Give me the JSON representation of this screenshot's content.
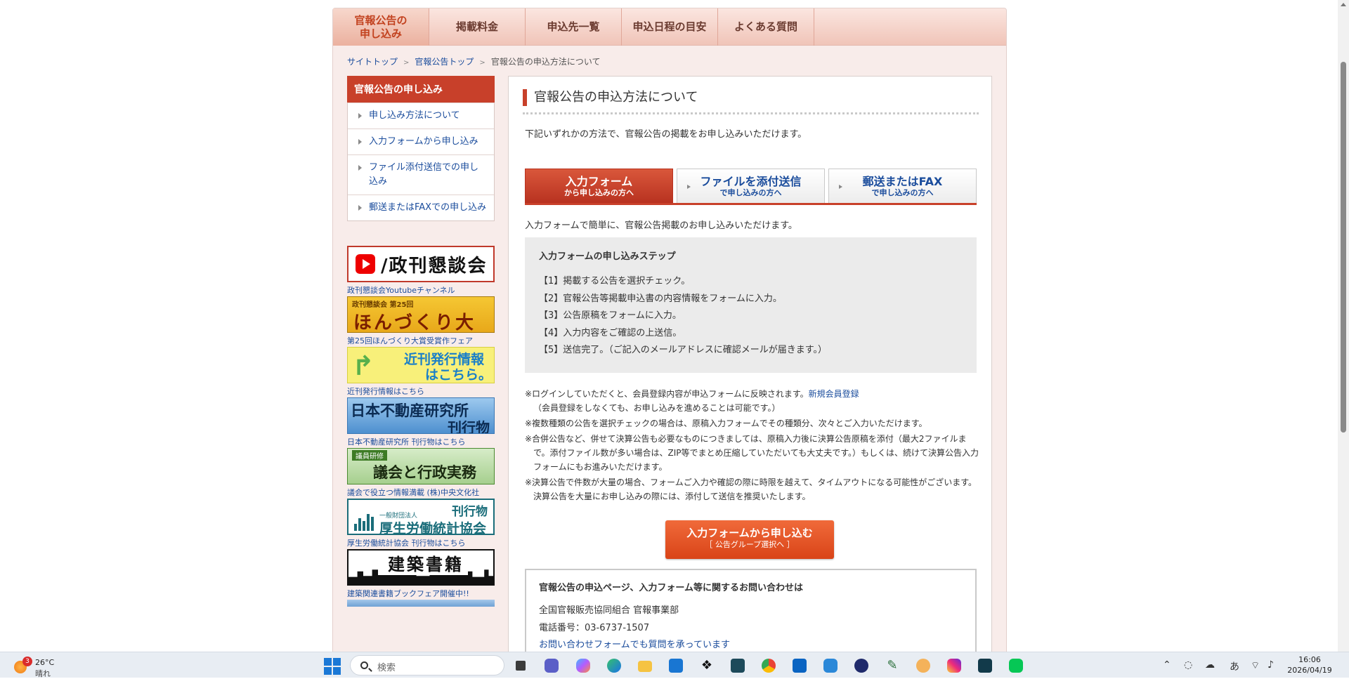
{
  "nav": {
    "tabs": [
      {
        "label": "官報公告の\n申し込み",
        "active": true
      },
      {
        "label": "掲載料金",
        "active": false
      },
      {
        "label": "申込先一覧",
        "active": false
      },
      {
        "label": "申込日程の目安",
        "active": false
      },
      {
        "label": "よくある質問",
        "active": false
      }
    ]
  },
  "breadcrumb": {
    "items": [
      "サイトトップ",
      "官報公告トップ",
      "官報公告の申込方法について"
    ]
  },
  "sidebar": {
    "heading": "官報公告の申し込み",
    "items": [
      "申し込み方法について",
      "入力フォームから申し込み",
      "ファイル添付送信での申し込み",
      "郵送またはFAXでの申し込み"
    ]
  },
  "banners": {
    "seikan": {
      "text": "/政刊懇談会",
      "caption": "政刊懇談会Youtubeチャンネル",
      "icon": "youtube-icon"
    },
    "honzukuri": {
      "small": "政刊懇談会 第25回",
      "big": "ほんづくり大賞",
      "caption": "第25回ほんづくり大賞受賞作フェア"
    },
    "kinkan": {
      "l1": "近刊発行情報",
      "l2": "はこちら。",
      "caption": "近刊発行情報はこちら"
    },
    "fudosan": {
      "l1": "日本不動産研究所",
      "l2": "刊行物",
      "caption": "日本不動産研究所 刊行物はこちら"
    },
    "gikai": {
      "tag": "議員研修",
      "big": "議会と行政実務",
      "caption": "議会で役立つ情報満載 (株)中央文化社"
    },
    "kosei": {
      "org": "一般財団法人",
      "name": "厚生労働統計協会",
      "kan": "刊行物",
      "caption": "厚生労働統計協会 刊行物はこちら"
    },
    "kenchiku": {
      "title": "建築書籍",
      "caption": "建築関連書籍ブックフェア開催中!!"
    }
  },
  "main": {
    "title": "官報公告の申込方法について",
    "intro": "下記いずれかの方法で、官報公告の掲載をお申し込みいただけます。",
    "tabs": [
      {
        "l1": "入力フォーム",
        "l2": "から申し込みの方へ",
        "active": true
      },
      {
        "l1": "ファイルを添付送信",
        "l2": "で申し込みの方へ",
        "active": false
      },
      {
        "l1": "郵送またはFAX",
        "l2": "で申し込みの方へ",
        "active": false
      }
    ],
    "form_desc": "入力フォームで簡単に、官報公告掲載のお申し込みいただけます。",
    "steps": {
      "heading": "入力フォームの申し込みステップ",
      "items": [
        "【1】掲載する公告を選択チェック。",
        "【2】官報公告等掲載申込書の内容情報をフォームに入力。",
        "【3】公告原稿をフォームに入力。",
        "【4】入力内容をご確認の上送信。",
        "【5】送信完了。（ご記入のメールアドレスに確認メールが届きます。）"
      ]
    },
    "notes": {
      "n1": "※ログインしていただくと、会員登録内容が申込フォームに反映されます。",
      "n1_link": "新規会員登録",
      "n1_sub": "（会員登録をしなくても、お申し込みを進めることは可能です。）",
      "n2": "※複数種類の公告を選択チェックの場合は、原稿入力フォームでその種類分、次々とご入力いただけます。",
      "n3": "※合併公告など、併せて決算公告も必要なものにつきましては、原稿入力後に決算公告原稿を添付（最大2ファイルまで。添付ファイル数が多い場合は、ZIP等でまとめ圧縮していただいても大丈夫です。）もしくは、続けて決算公告入力フォームにもお進みいただけます。",
      "n4": "※決算公告で件数が大量の場合、フォームご入力や確認の際に時限を越えて、タイムアウトになる可能性がございます。決算公告を大量にお申し込みの際には、添付して送信を推奨いたします。"
    },
    "cta": {
      "l1": "入力フォームから申し込む",
      "l2": "［ 公告グループ選択へ ］"
    },
    "contact": {
      "heading": "官報公告の申込ページ、入力フォーム等に関するお問い合わせは",
      "org": "全国官報販売協同組合 官報事業部",
      "tel": "電話番号：03-6737-1507",
      "link": "お問い合わせフォームでも質問を承っています"
    }
  },
  "taskbar": {
    "weather": {
      "temp": "26°C",
      "cond": "晴れ",
      "badge": "3"
    },
    "search_placeholder": "検索",
    "apps": [
      "file-explorer-icon",
      "teams-icon",
      "copilot-icon",
      "edge-icon",
      "folder-icon",
      "store-icon",
      "dropbox-icon",
      "app-s-icon",
      "chrome-icon",
      "outlook-icon",
      "outlook-new-icon",
      "app-circle-icon",
      "app-pen-icon",
      "app-flower-icon",
      "instagram-icon",
      "app-terminal-icon",
      "line-icon"
    ],
    "tray": {
      "ime": "あ"
    },
    "clock": {
      "time": "16:06",
      "date": "2026/04/19"
    }
  }
}
